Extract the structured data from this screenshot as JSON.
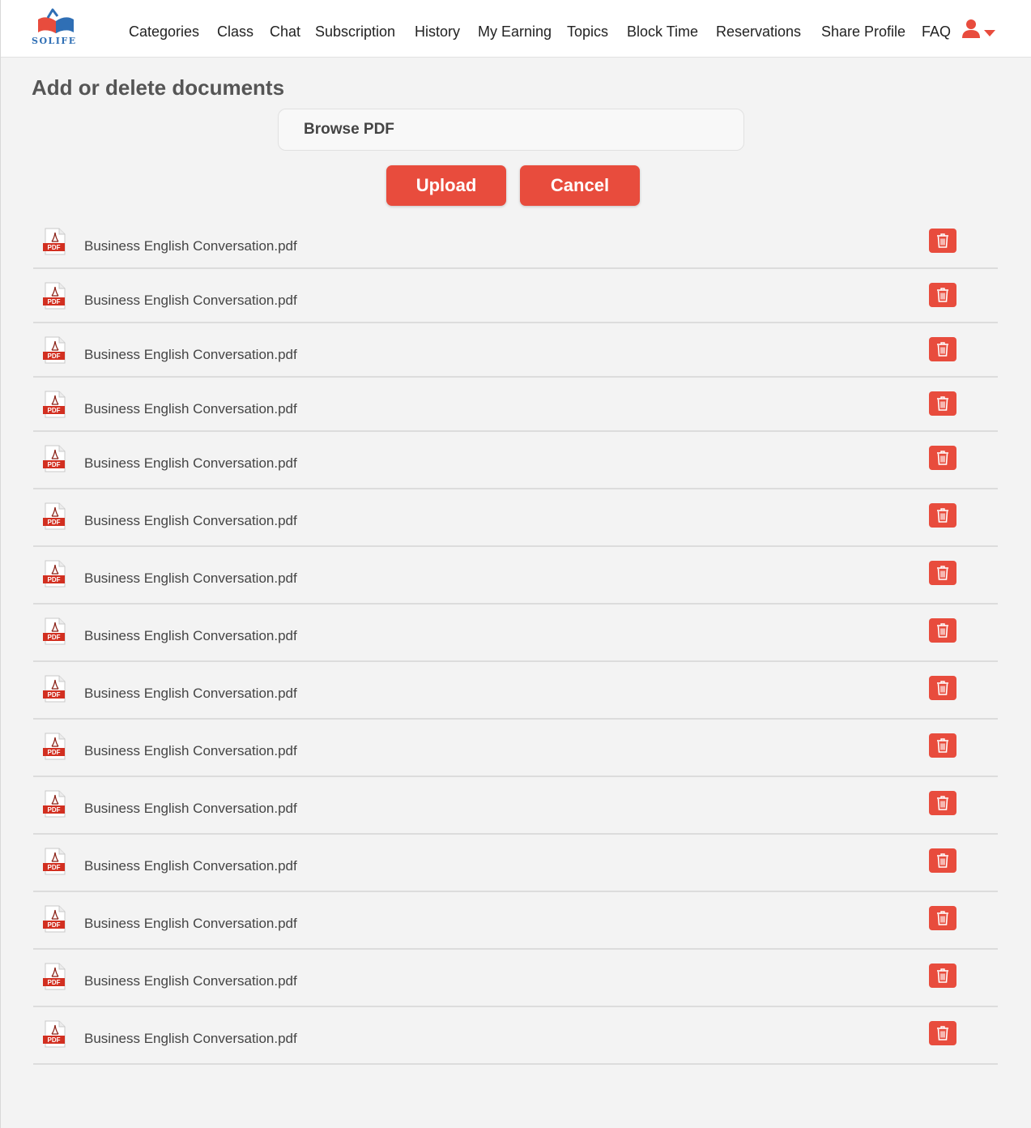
{
  "brand": {
    "logo_text": "SOLIFE",
    "accent": "#e84c3d",
    "secondary": "#2f6fb5"
  },
  "nav": {
    "items": [
      "Categories",
      "Class",
      "Chat",
      "Subscription",
      "History",
      "My Earning",
      "Topics",
      "Block Time",
      "Reservations",
      "Share Profile",
      "FAQ"
    ],
    "user_icon": "user-icon",
    "dropdown_icon": "caret-down-icon"
  },
  "page": {
    "title": "Add or delete documents",
    "browse_label": "Browse PDF",
    "upload_label": "Upload",
    "cancel_label": "Cancel"
  },
  "documents": [
    {
      "name": "Business English Conversation.pdf",
      "icon_label": "PDF"
    },
    {
      "name": "Business English Conversation.pdf",
      "icon_label": "PDF"
    },
    {
      "name": "Business English Conversation.pdf",
      "icon_label": "PDF"
    },
    {
      "name": "Business English Conversation.pdf",
      "icon_label": "PDF"
    },
    {
      "name": "Business English Conversation.pdf",
      "icon_label": "PDF"
    },
    {
      "name": "Business English Conversation.pdf",
      "icon_label": "PDF"
    },
    {
      "name": "Business English Conversation.pdf",
      "icon_label": "PDF"
    },
    {
      "name": "Business English Conversation.pdf",
      "icon_label": "PDF"
    },
    {
      "name": "Business English Conversation.pdf",
      "icon_label": "PDF"
    },
    {
      "name": "Business English Conversation.pdf",
      "icon_label": "PDF"
    },
    {
      "name": "Business English Conversation.pdf",
      "icon_label": "PDF"
    },
    {
      "name": "Business English Conversation.pdf",
      "icon_label": "PDF"
    },
    {
      "name": "Business English Conversation.pdf",
      "icon_label": "PDF"
    },
    {
      "name": "Business English Conversation.pdf",
      "icon_label": "PDF"
    },
    {
      "name": "Business English Conversation.pdf",
      "icon_label": "PDF"
    }
  ]
}
